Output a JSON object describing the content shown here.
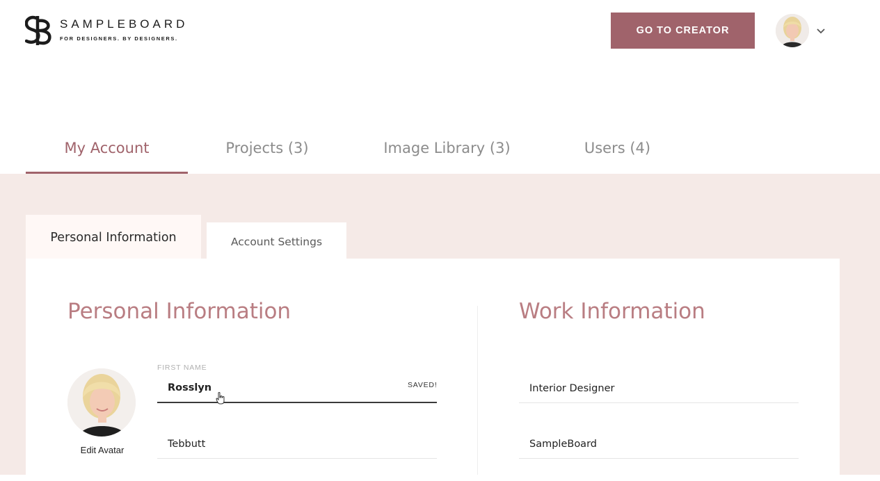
{
  "header": {
    "brand_name": "SAMPLEBOARD",
    "brand_tagline": "FOR DESIGNERS. BY DESIGNERS.",
    "cta_label": "GO TO CREATOR",
    "accent_color": "#a0636b",
    "user_menu_icon": "chevron-down-icon"
  },
  "main_tabs": [
    {
      "label": "My Account",
      "active": true
    },
    {
      "label": "Projects (3)",
      "active": false
    },
    {
      "label": "Image Library (3)",
      "active": false
    },
    {
      "label": "Users (4)",
      "active": false
    }
  ],
  "sub_tabs": [
    {
      "label": "Personal Information",
      "active": true
    },
    {
      "label": "Account Settings",
      "active": false
    }
  ],
  "personal": {
    "title": "Personal Information",
    "edit_avatar_label": "Edit Avatar",
    "first_name_label": "FIRST NAME",
    "first_name_value": "Rosslyn",
    "saved_status": "SAVED!",
    "last_name_value": "Tebbutt"
  },
  "work": {
    "title": "Work Information",
    "job_title_value": "Interior Designer",
    "company_value": "SampleBoard"
  }
}
